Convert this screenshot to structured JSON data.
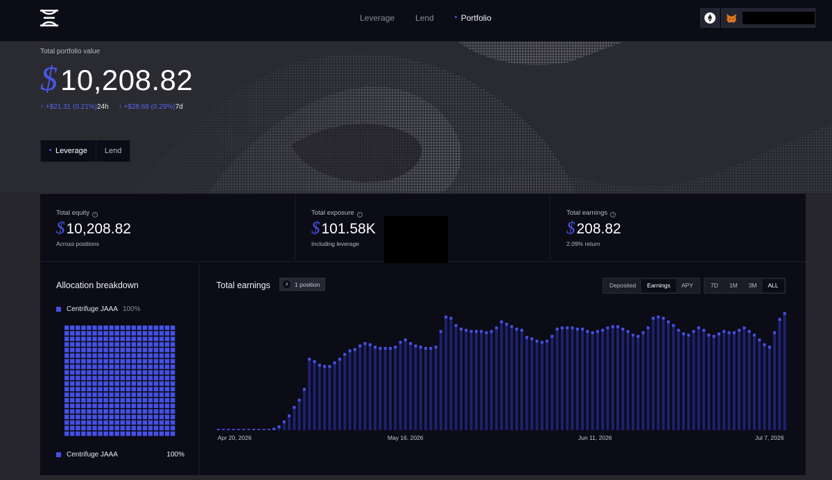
{
  "nav": {
    "items": [
      {
        "label": "Leverage",
        "active": false
      },
      {
        "label": "Lend",
        "active": false
      },
      {
        "label": "Portfolio",
        "active": true
      }
    ],
    "chain_icon": "ethereum-icon",
    "wallet_icon": "metamask-fox-icon"
  },
  "hero": {
    "label": "Total portfolio value",
    "currency": "$",
    "value": "10,208.82",
    "change_24h": {
      "value": "↑ +$21.31 (0.21%)",
      "period": "24h"
    },
    "change_7d": {
      "value": "↑ +$28.68 (0.29%)",
      "period": "7d"
    },
    "toggle": [
      {
        "label": "Leverage",
        "active": true
      },
      {
        "label": "Lend",
        "active": false
      }
    ]
  },
  "stats": [
    {
      "label": "Total equity",
      "currency": "$",
      "value": "10,208.82",
      "sub": "Across positions"
    },
    {
      "label": "Total exposure",
      "currency": "$",
      "value": "101.58K",
      "sub": "Including leverage"
    },
    {
      "label": "Total earnings",
      "currency": "$",
      "value": "208.82",
      "sub": "2.09% return"
    }
  ],
  "allocation": {
    "title": "Allocation breakdown",
    "legend": {
      "name": "Centrifuge JAAA",
      "percent": "100%"
    },
    "footer": {
      "name": "Centrifuge JAAA",
      "percent": "100%"
    },
    "share_percent": 100,
    "color": "#4651e4"
  },
  "earnings": {
    "title": "Total earnings",
    "badge": "1 position",
    "metric_tabs": [
      {
        "label": "Deposited",
        "active": false
      },
      {
        "label": "Earnings",
        "active": true
      },
      {
        "label": "APY",
        "active": false
      }
    ],
    "range_tabs": [
      {
        "label": "7D",
        "active": false
      },
      {
        "label": "1M",
        "active": false
      },
      {
        "label": "3M",
        "active": false
      },
      {
        "label": "ALL",
        "active": true
      }
    ]
  },
  "chart_data": {
    "type": "bar",
    "x_tick_labels": [
      "Apr 20, 2026",
      "May 16, 2026",
      "Jun 11, 2026",
      "Jul 7, 2026"
    ],
    "ylim": [
      0,
      100
    ],
    "grid": false,
    "color": "#4651e4",
    "values": [
      1,
      1,
      1,
      1,
      1,
      1,
      1,
      1,
      1,
      1,
      1,
      2,
      4,
      8,
      13,
      20,
      26,
      35,
      60,
      58,
      55,
      54,
      54,
      57,
      60,
      64,
      67,
      68,
      71,
      73,
      72,
      70,
      69,
      69,
      69,
      70,
      74,
      76,
      73,
      71,
      70,
      69,
      69,
      70,
      83,
      95,
      94,
      88,
      85,
      84,
      83,
      83,
      83,
      82,
      83,
      86,
      91,
      89,
      87,
      85,
      84,
      78,
      77,
      75,
      74,
      75,
      79,
      85,
      86,
      86,
      86,
      85,
      85,
      83,
      82,
      83,
      84,
      86,
      87,
      87,
      85,
      83,
      80,
      79,
      82,
      86,
      94,
      95,
      94,
      91,
      88,
      84,
      81,
      80,
      83,
      86,
      84,
      80,
      79,
      81,
      83,
      82,
      82,
      84,
      86,
      83,
      80,
      76,
      72,
      70,
      82,
      93,
      98
    ]
  }
}
